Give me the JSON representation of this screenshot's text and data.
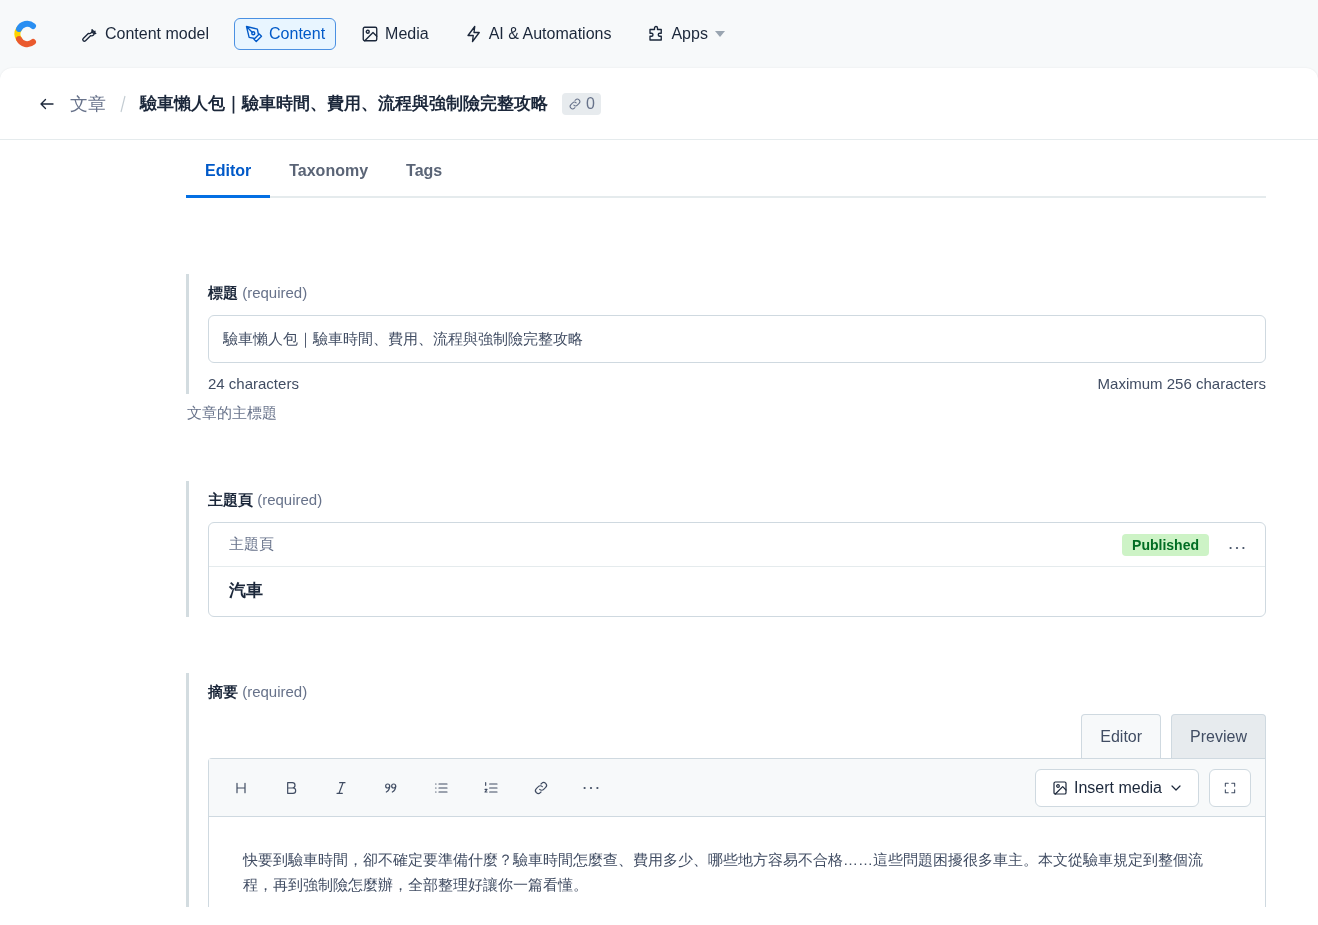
{
  "nav": {
    "items": [
      {
        "label": "Content model",
        "selected": false,
        "dropdown": false
      },
      {
        "label": "Content",
        "selected": true,
        "dropdown": false
      },
      {
        "label": "Media",
        "selected": false,
        "dropdown": false
      },
      {
        "label": "AI & Automations",
        "selected": false,
        "dropdown": false
      },
      {
        "label": "Apps",
        "selected": false,
        "dropdown": true
      }
    ]
  },
  "header": {
    "breadcrumb": "文章",
    "title": "驗車懶人包｜驗車時間、費用、流程與強制險完整攻略",
    "links_count": "0"
  },
  "tabs": [
    {
      "label": "Editor",
      "selected": true
    },
    {
      "label": "Taxonomy",
      "selected": false
    },
    {
      "label": "Tags",
      "selected": false
    }
  ],
  "fields": [
    {
      "kind": "text",
      "label": "標題",
      "required": "(required)",
      "value": "驗車懶人包｜驗車時間、費用、流程與強制險完整攻略",
      "count": "24 characters",
      "max": "Maximum 256 characters",
      "help": "文章的主標題"
    },
    {
      "kind": "reference",
      "label": "主題頁",
      "required": "(required)",
      "entry_type": "主題頁",
      "status": "Published",
      "entry_title": "汽車"
    },
    {
      "kind": "markdown",
      "label": "摘要",
      "required": "(required)",
      "modes": [
        {
          "label": "Editor",
          "selected": true
        },
        {
          "label": "Preview",
          "selected": false
        }
      ],
      "insert": "Insert media",
      "body": "快要到驗車時間，卻不確定要準備什麼？驗車時間怎麼查、費用多少、哪些地方容易不合格……這些問題困擾很多車主。本文從驗車規定到整個流程，再到強制險怎麼辦，全部整理好讓你一篇看懂。"
    }
  ]
}
